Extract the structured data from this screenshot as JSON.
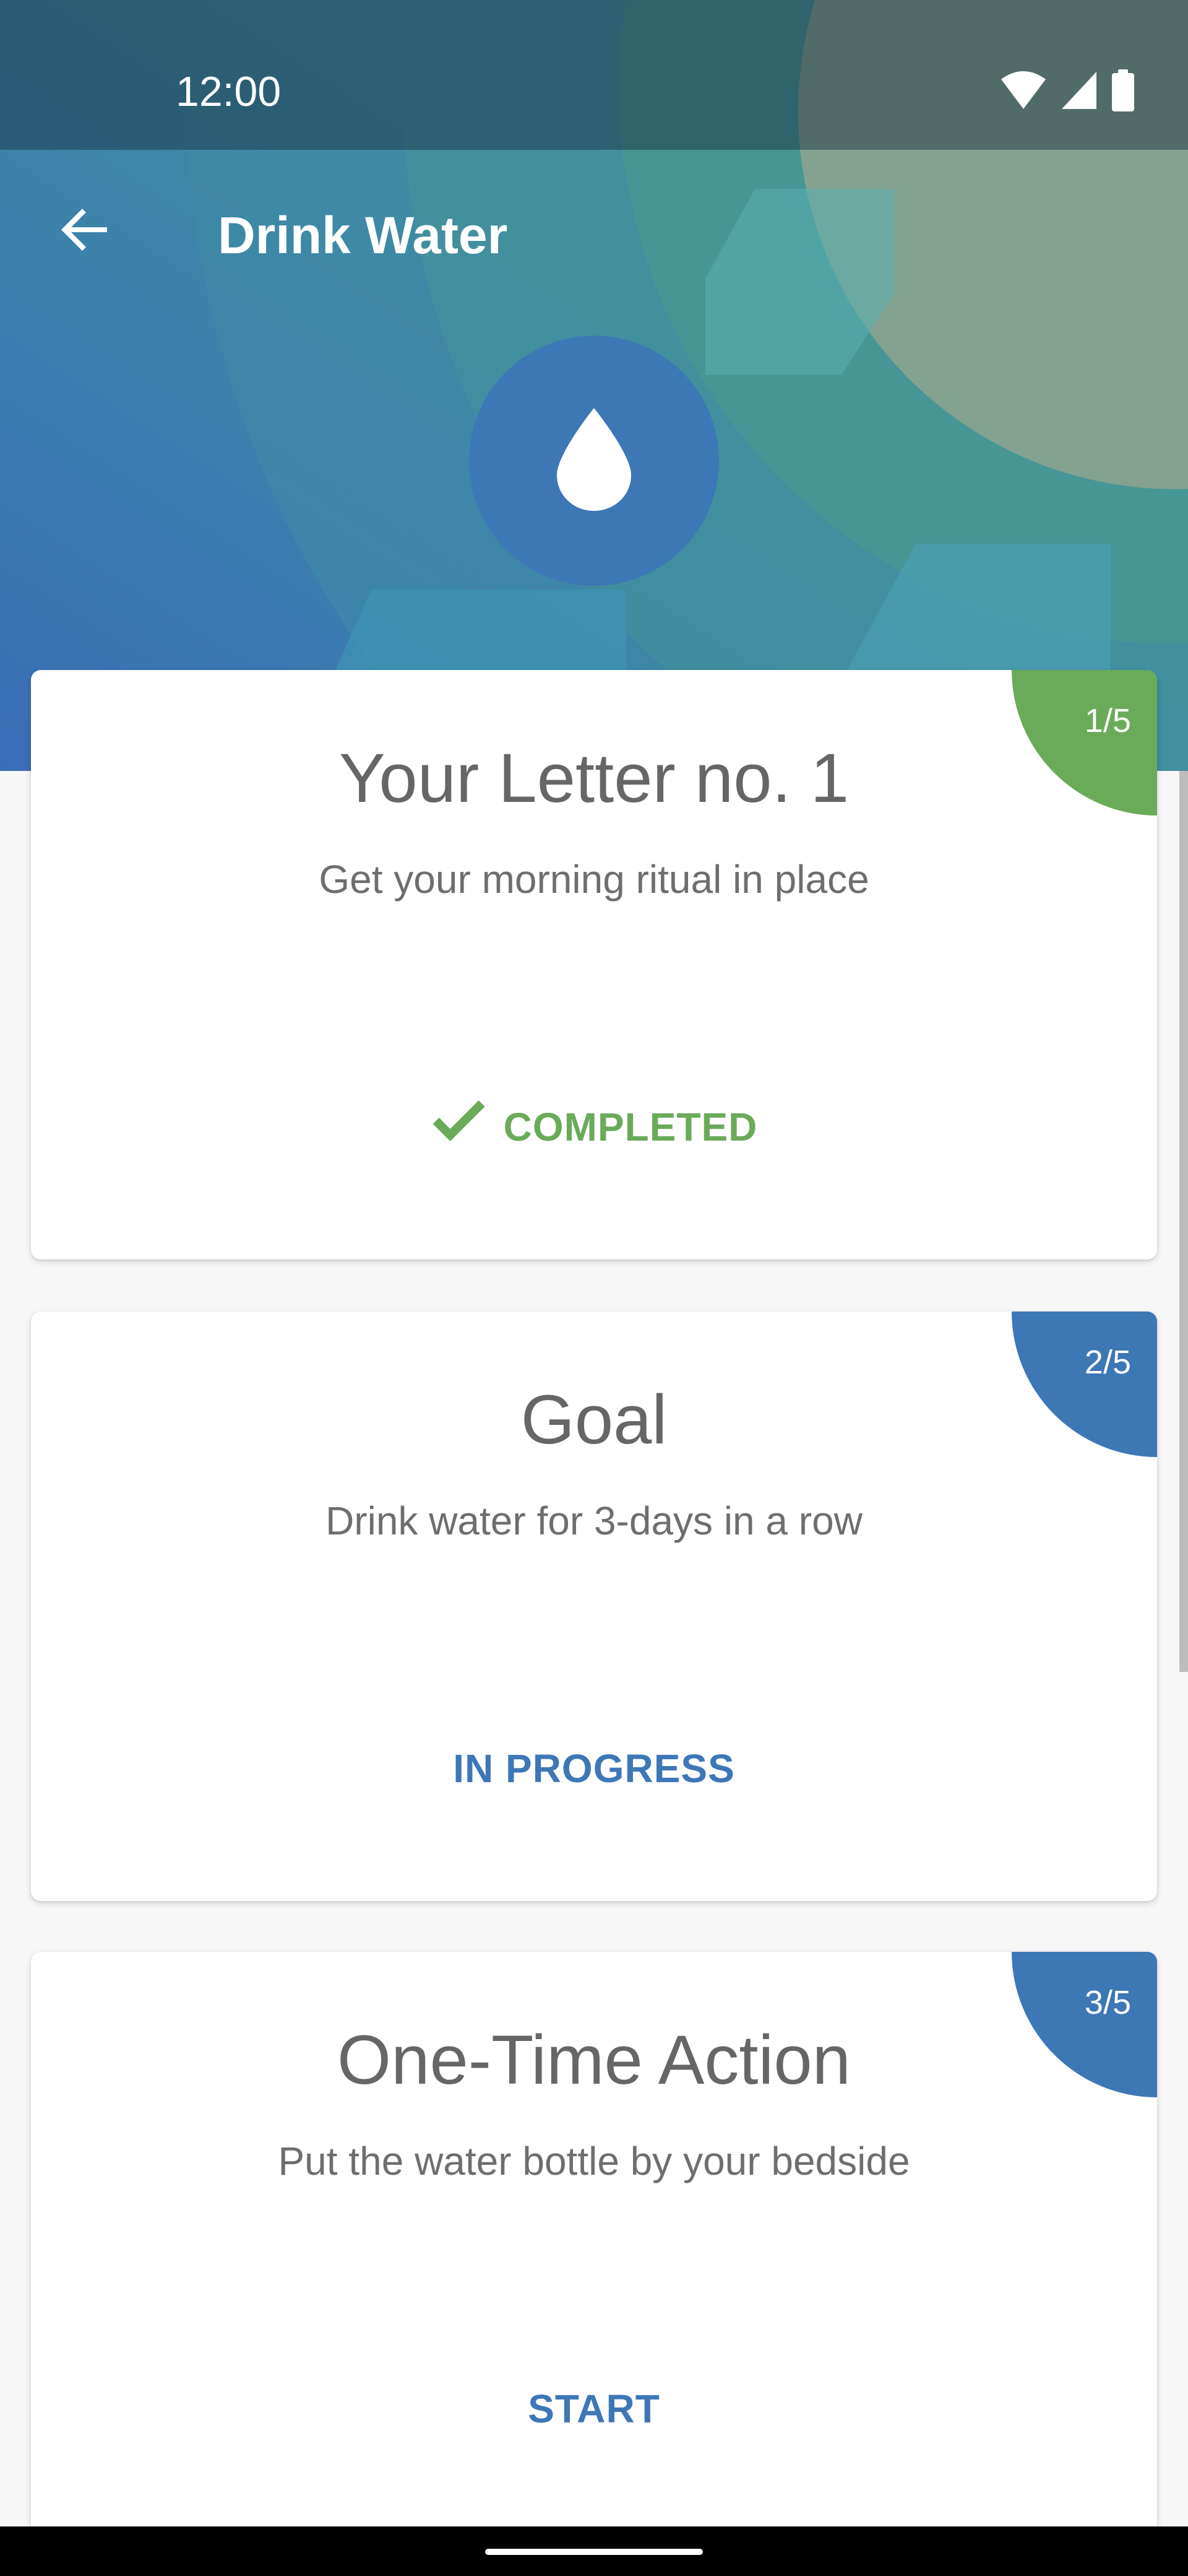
{
  "colors": {
    "completed": "#6aab5a",
    "progress": "#3d77b6",
    "badge_green": "#6aab5a",
    "badge_blue": "#3d77b6",
    "hero_teal": "#479b8f",
    "hero_blue": "#3a6fb3"
  },
  "status_bar": {
    "time": "12:00",
    "icons": [
      "wifi-icon",
      "cell-signal-icon",
      "battery-icon"
    ]
  },
  "app_bar": {
    "back_icon": "arrow-left-icon",
    "title": "Drink Water"
  },
  "hero": {
    "icon": "water-drop-icon"
  },
  "cards": [
    {
      "step": "1/5",
      "title": "Your Letter no. 1",
      "subtitle": "Get your morning ritual in place",
      "action": "COMPLETED",
      "action_icon": "checkmark-icon",
      "status_color": "#6aab5a"
    },
    {
      "step": "2/5",
      "title": "Goal",
      "subtitle": "Drink water for 3-days in a row",
      "action": "IN PROGRESS",
      "status_color": "#3d77b6"
    },
    {
      "step": "3/5",
      "title": "One-Time Action",
      "subtitle": "Put the water bottle by your bedside",
      "action": "START",
      "status_color": "#3d77b6"
    }
  ]
}
